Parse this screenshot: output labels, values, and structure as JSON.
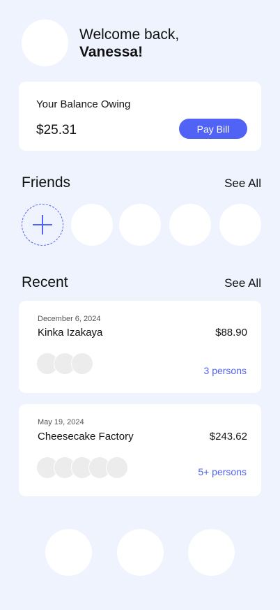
{
  "header": {
    "greeting": "Welcome back,",
    "user_name": "Vanessa!"
  },
  "balance": {
    "label": "Your Balance Owing",
    "amount": "$25.31",
    "pay_button_label": "Pay Bill"
  },
  "friends": {
    "title": "Friends",
    "see_all_label": "See All",
    "add_icon": "plus-icon"
  },
  "recent": {
    "title": "Recent",
    "see_all_label": "See All",
    "items": [
      {
        "date": "December 6, 2024",
        "title": "Kinka Izakaya",
        "amount": "$88.90",
        "persons": "3 persons"
      },
      {
        "date": "May 19, 2024",
        "title": "Cheesecake Factory",
        "amount": "$243.62",
        "persons": "5+ persons"
      }
    ]
  },
  "colors": {
    "background": "#eef3fe",
    "accent": "#5063f5",
    "card": "#ffffff",
    "avatar_placeholder": "#ececec"
  }
}
